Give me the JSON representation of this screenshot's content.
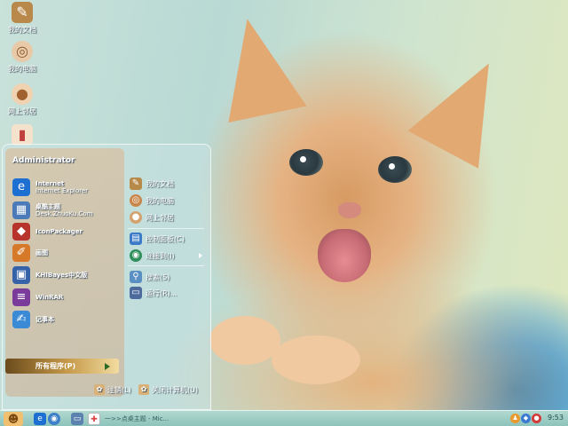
{
  "desktop_icons": [
    {
      "label": "我的文档",
      "icon": "folder-docs-icon"
    },
    {
      "label": "我的电脑",
      "icon": "computer-icon"
    },
    {
      "label": "网上邻居",
      "icon": "network-icon"
    },
    {
      "label": "",
      "icon": "recycle-bin-icon"
    }
  ],
  "start_menu": {
    "user": "Administrator",
    "pinned": [
      {
        "title": "Internet",
        "subtitle": "Internet Explorer",
        "icon": "internet-explorer-icon",
        "color": "#1d6fd1"
      },
      {
        "title": "桌酷主题",
        "subtitle": "Desk.ZhuoKu.Com",
        "icon": "zhuoku-icon",
        "color": "#4a7ab8"
      }
    ],
    "recent": [
      {
        "title": "IconPackager",
        "icon": "iconpackager-icon",
        "color": "#b8332c"
      },
      {
        "title": "画图",
        "icon": "paint-icon",
        "color": "#d67a2a"
      },
      {
        "title": "KHIBayes中文版",
        "icon": "khibayes-icon",
        "color": "#3562a8"
      },
      {
        "title": "WinRAR",
        "icon": "winrar-icon",
        "color": "#7b3b9a"
      },
      {
        "title": "记事本",
        "icon": "notepad-icon",
        "color": "#3b8ad6"
      }
    ],
    "all_programs": "所有程序(P)",
    "right": [
      {
        "label": "我的文档",
        "icon": "folder-docs-icon",
        "color": "#b88a4a"
      },
      {
        "label": "我的电脑",
        "icon": "computer-icon",
        "color": "#c9864a"
      },
      {
        "label": "网上邻居",
        "icon": "network-icon",
        "color": "#d4a26e"
      },
      {
        "label": "控制面板(C)",
        "icon": "control-panel-icon",
        "color": "#3a7ac6"
      },
      {
        "label": "连接到(I)",
        "icon": "connect-icon",
        "color": "#2f8f5a"
      },
      {
        "label": "搜索(S)",
        "icon": "search-icon",
        "color": "#5a8fc4"
      },
      {
        "label": "运行(R)...",
        "icon": "run-icon",
        "color": "#4c6a9c"
      }
    ],
    "logoff": "注销(L)",
    "shutdown": "关闭计算机(U)"
  },
  "taskbar": {
    "task_label": "一>>点桌主题 - Mic...",
    "clock": "9:53"
  },
  "colors": {
    "taskbar": "#9fd0c7",
    "all_programs_bar": "#c69a4a"
  }
}
